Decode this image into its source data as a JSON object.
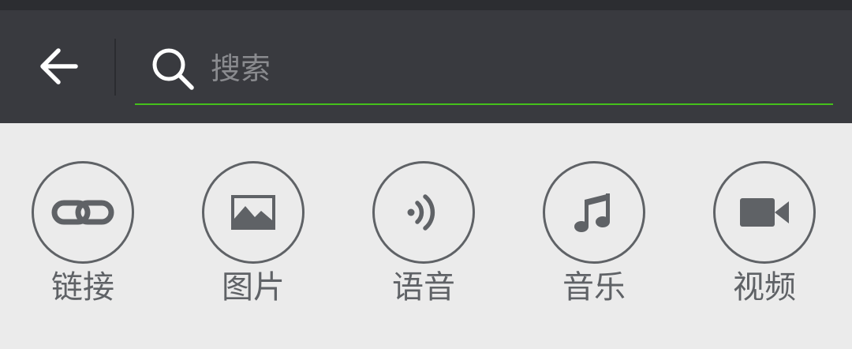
{
  "search": {
    "placeholder": "搜索",
    "value": ""
  },
  "colors": {
    "toolbar": "#393a3f",
    "accent_underline": "#45c01a",
    "icon_gray": "#5f6266",
    "background": "#ebebeb"
  },
  "categories": [
    {
      "label": "链接",
      "icon": "link-icon"
    },
    {
      "label": "图片",
      "icon": "image-icon"
    },
    {
      "label": "语音",
      "icon": "voice-icon"
    },
    {
      "label": "音乐",
      "icon": "music-icon"
    },
    {
      "label": "视频",
      "icon": "video-icon"
    }
  ]
}
